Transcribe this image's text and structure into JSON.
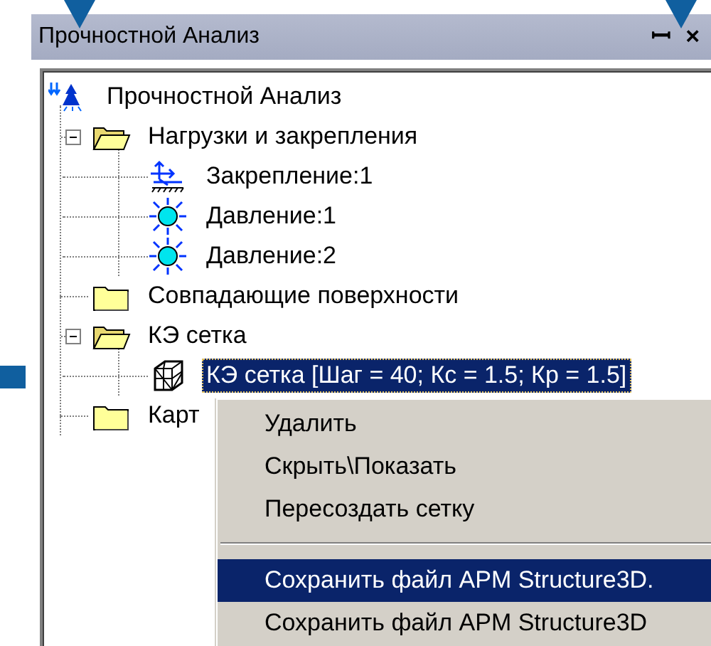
{
  "panel": {
    "title": "Прочностной Анализ",
    "pin": "ꟷ",
    "close": "×"
  },
  "tree": [
    {
      "label": "Прочностной Анализ",
      "kind": "analysis",
      "selected": false,
      "children": [
        {
          "label": "Нагрузки и закрепления",
          "kind": "folder",
          "selected": false,
          "expanded": true,
          "children": [
            {
              "label": "Закрепление:1",
              "kind": "fixture",
              "selected": false
            },
            {
              "label": "Давление:1",
              "kind": "pressure",
              "selected": false
            },
            {
              "label": "Давление:2",
              "kind": "pressure",
              "selected": false
            }
          ]
        },
        {
          "label": "Совпадающие поверхности",
          "kind": "folder",
          "selected": false
        },
        {
          "label": "КЭ сетка",
          "kind": "folder",
          "selected": false,
          "expanded": true,
          "children": [
            {
              "label": "КЭ сетка [Шаг = 40; Кс = 1.5; Кр = 1.5]",
              "kind": "mesh",
              "selected": true
            }
          ]
        },
        {
          "label": "Карт",
          "kind": "folder",
          "selected": false
        }
      ]
    }
  ],
  "context_menu": [
    {
      "label": "Удалить",
      "kind": "item",
      "selected": false
    },
    {
      "label": "Скрыть\\Показать",
      "kind": "item",
      "selected": false
    },
    {
      "label": "Пересоздать сетку",
      "kind": "item",
      "selected": false
    },
    {
      "kind": "separator"
    },
    {
      "label": "Сохранить файл APM Structure3D.",
      "kind": "item",
      "selected": true
    },
    {
      "label": "Сохранить файл APM Structure3D",
      "kind": "item",
      "selected": false
    }
  ]
}
